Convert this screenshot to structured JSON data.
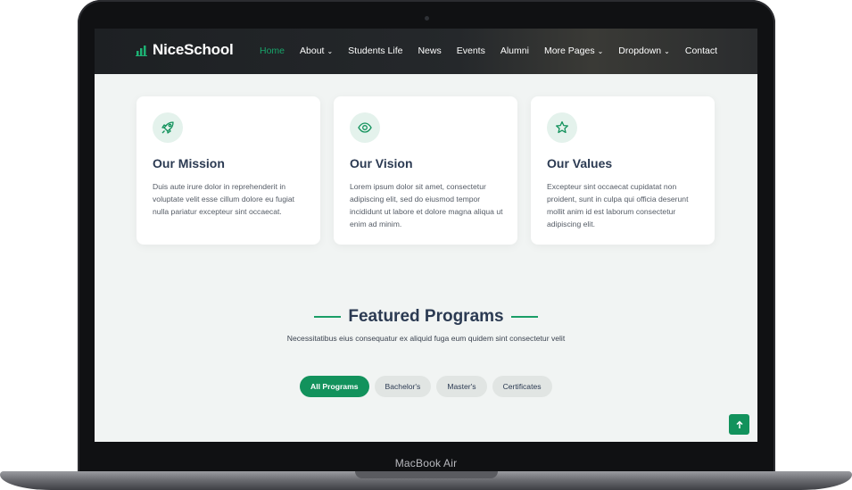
{
  "device": {
    "label": "MacBook Air"
  },
  "navbar": {
    "logo": "NiceSchool",
    "items": [
      {
        "label": "Home",
        "active": true,
        "dropdown": false
      },
      {
        "label": "About",
        "active": false,
        "dropdown": true
      },
      {
        "label": "Students Life",
        "active": false,
        "dropdown": false
      },
      {
        "label": "News",
        "active": false,
        "dropdown": false
      },
      {
        "label": "Events",
        "active": false,
        "dropdown": false
      },
      {
        "label": "Alumni",
        "active": false,
        "dropdown": false
      },
      {
        "label": "More Pages",
        "active": false,
        "dropdown": true
      },
      {
        "label": "Dropdown",
        "active": false,
        "dropdown": true
      },
      {
        "label": "Contact",
        "active": false,
        "dropdown": false
      }
    ]
  },
  "cards": [
    {
      "icon": "rocket-icon",
      "title": "Our Mission",
      "text": "Duis aute irure dolor in reprehenderit in voluptate velit esse cillum dolore eu fugiat nulla pariatur excepteur sint occaecat."
    },
    {
      "icon": "eye-icon",
      "title": "Our Vision",
      "text": "Lorem ipsum dolor sit amet, consectetur adipiscing elit, sed do eiusmod tempor incididunt ut labore et dolore magna aliqua ut enim ad minim."
    },
    {
      "icon": "star-icon",
      "title": "Our Values",
      "text": "Excepteur sint occaecat cupidatat non proident, sunt in culpa qui officia deserunt mollit anim id est laborum consectetur adipiscing elit."
    }
  ],
  "featured": {
    "title": "Featured Programs",
    "subtitle": "Necessitatibus eius consequatur ex aliquid fuga eum quidem sint consectetur velit",
    "filters": [
      {
        "label": "All Programs",
        "active": true
      },
      {
        "label": "Bachelor's",
        "active": false
      },
      {
        "label": "Master's",
        "active": false
      },
      {
        "label": "Certificates",
        "active": false
      }
    ]
  },
  "colors": {
    "accent": "#12925c",
    "heading": "#2b3a52",
    "navbar": "#1d2023"
  }
}
